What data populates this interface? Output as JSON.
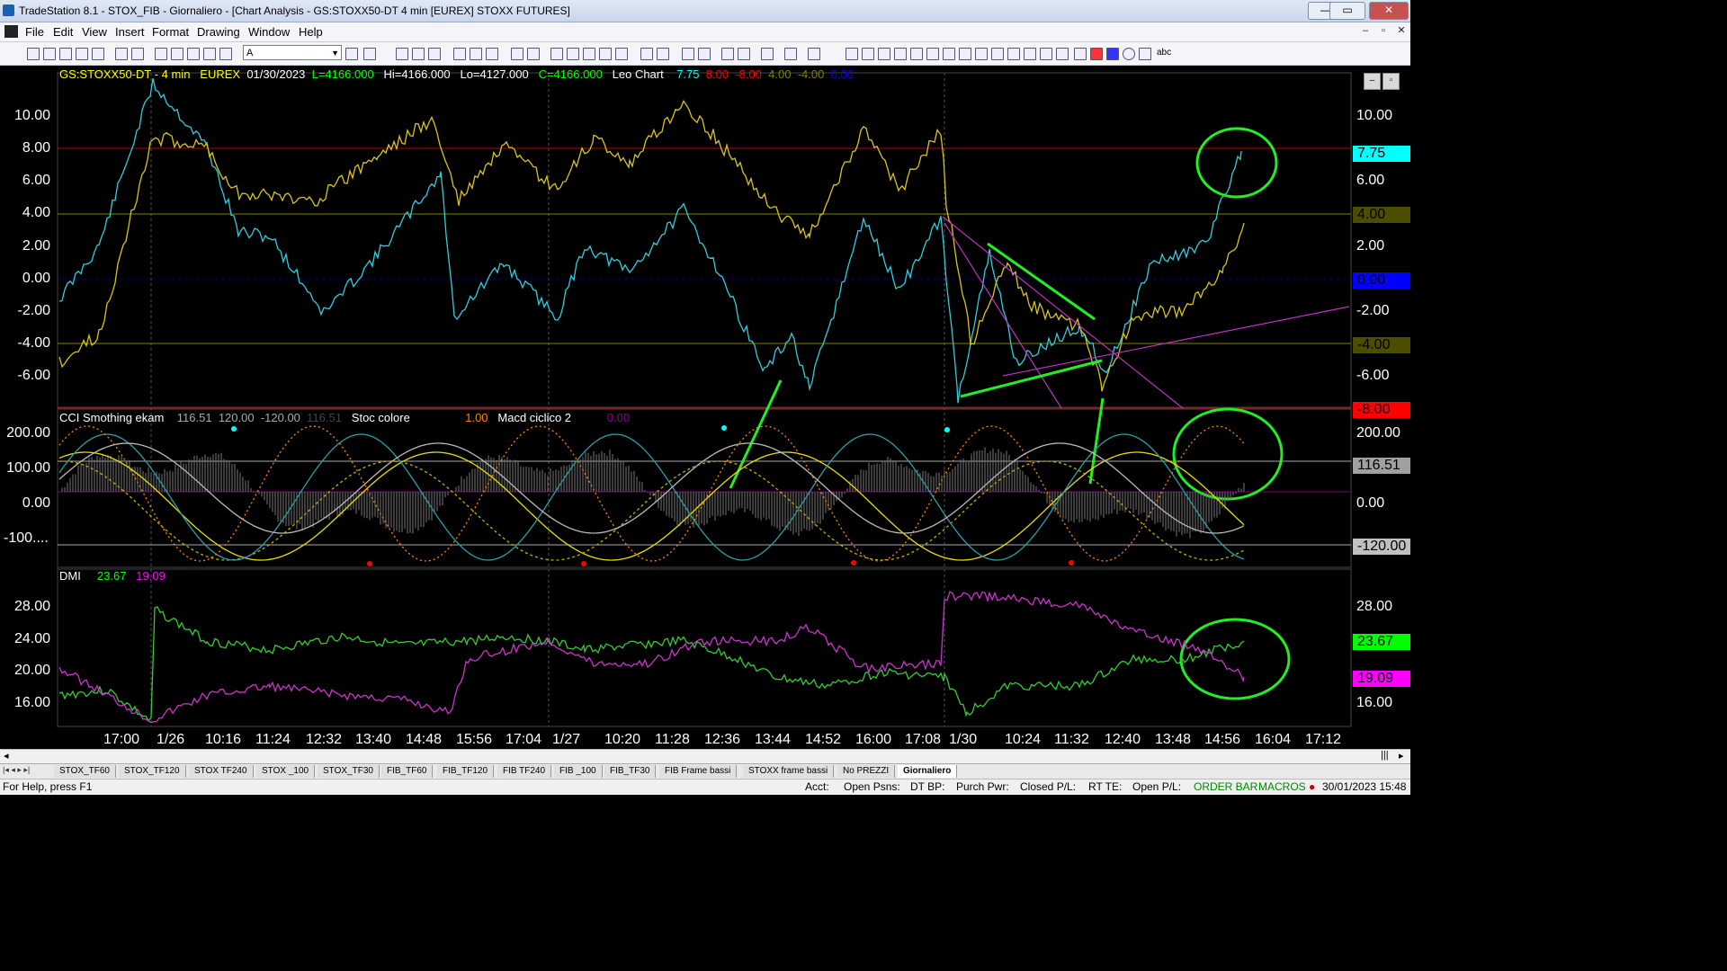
{
  "window": {
    "title": "TradeStation 8.1 - STOX_FIB - Giornaliero - [Chart Analysis - GS:STOXX50-DT  4 min  [EUREX] STOXX FUTURES]",
    "minimize": "—",
    "restore": "▭",
    "close": "✕"
  },
  "menu": [
    "File",
    "Edit",
    "View",
    "Insert",
    "Format",
    "Drawing",
    "Window",
    "Help"
  ],
  "toolbar": {
    "font_value": "A"
  },
  "price_header": {
    "symbol": "GS:STOXX50-DT - 4 min",
    "exchange": "EUREX",
    "date": "01/30/2023",
    "last": "L=4166.000",
    "high": "Hi=4166.000",
    "low": "Lo=4127.000",
    "close": "C=4166.000",
    "study": "Leo Chart",
    "v1": "7.75",
    "v2": "8.00",
    "v3": "-8.00",
    "v4": "4.00",
    "v5": "-4.00",
    "v6": "0.00"
  },
  "pane1_axis": [
    "10.00",
    "8.00",
    "6.00",
    "4.00",
    "2.00",
    "0.00",
    "-2.00",
    "-4.00",
    "-6.00"
  ],
  "pane1_badges": [
    {
      "label": "7.75",
      "bg": "#00ffff",
      "fg": "#000"
    },
    {
      "label": "4.00",
      "bg": "#4d4d00",
      "fg": "#000"
    },
    {
      "label": "0.00",
      "bg": "#0000ff",
      "fg": "#000"
    },
    {
      "label": "-4.00",
      "bg": "#4d4d00",
      "fg": "#000"
    },
    {
      "label": "-8.00",
      "bg": "#ff0000",
      "fg": "#000"
    }
  ],
  "osc_header": {
    "name": "CCI Smothing ekam",
    "v1": "116.51",
    "v2": "120.00",
    "v3": "-120.00",
    "v4": "116.51",
    "stoc": "Stoc colore",
    "stoc_v": "1.00",
    "macd": "Macd ciclico 2",
    "macd_v": "0.00"
  },
  "pane2_axis": [
    "200.00",
    "100.00",
    "0.00",
    "-100...."
  ],
  "pane2_raxis": [
    "200.00",
    "0.00",
    "100.00"
  ],
  "pane2_badges": [
    {
      "label": "116.51",
      "bg": "#a0a0a0",
      "fg": "#000"
    },
    {
      "label": "-120.00",
      "bg": "#c0c0c0",
      "fg": "#000"
    }
  ],
  "dmi_header": {
    "name": "DMI",
    "v1": "23.67",
    "v2": "19.09"
  },
  "pane3_axis": [
    "28.00",
    "24.00",
    "20.00",
    "16.00"
  ],
  "pane3_badges": [
    {
      "label": "23.67",
      "bg": "#00ff00",
      "fg": "#000"
    },
    {
      "label": "19.09",
      "bg": "#ff00ff",
      "fg": "#000"
    }
  ],
  "x_axis": [
    "17:00",
    "1/26",
    "10:16",
    "11:24",
    "12:32",
    "13:40",
    "14:48",
    "15:56",
    "17:04",
    "1/27",
    "10:20",
    "11:28",
    "12:36",
    "13:44",
    "14:52",
    "16:00",
    "17:08",
    "1/30",
    "10:24",
    "11:32",
    "12:40",
    "13:48",
    "14:56",
    "16:04",
    "17:12"
  ],
  "tabs": [
    "STOX_TF60",
    "STOX_TF120",
    "STOX TF240",
    "STOX _100",
    "STOX_TF30",
    "FIB_TF60",
    "FIB_TF120",
    "FIB TF240",
    "FIB _100",
    "FIB_TF30",
    "FIB Frame bassi",
    "STOXX frame bassi",
    "No PREZZI",
    "Giornaliero"
  ],
  "status": {
    "help": "For Help, press F1",
    "acct": "Acct:",
    "open_psns": "Open Psns:",
    "dt_bp": "DT BP:",
    "purch_pwr": "Purch Pwr:",
    "closed_pl": "Closed P/L:",
    "rt_te": "RT TE:",
    "open_pl": "Open P/L:",
    "orderbar": "ORDER BAR",
    "macros": "MACROS",
    "datetime": "30/01/2023 15:48"
  }
}
